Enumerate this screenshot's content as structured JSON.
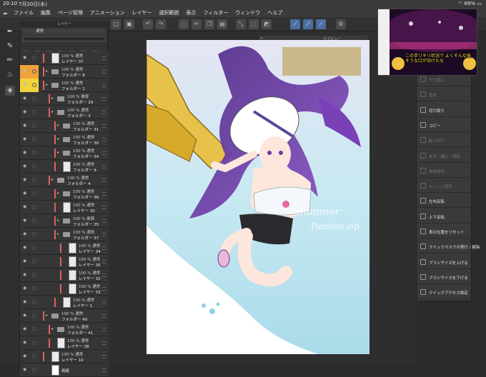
{
  "status_bar": {
    "time": "20:10",
    "date": "7月20日(水)",
    "battery": "69%"
  },
  "menu_bar": {
    "items": [
      "ファイル",
      "編集",
      "ページ管理",
      "アニメーション",
      "レイヤー",
      "選択範囲",
      "表示",
      "フィルター",
      "ウィンドウ",
      "ヘルプ"
    ]
  },
  "layer_panel": {
    "title": "レイヤー",
    "blend_mode": "通常",
    "layers": [
      {
        "line1": "100 % 通常",
        "line2": "レイヤー 37",
        "kind": "layer",
        "indent": 40,
        "color": ""
      },
      {
        "line1": "100 % 通常",
        "line2": "フォルダー 8",
        "kind": "folder",
        "indent": 40,
        "color": "orange"
      },
      {
        "line1": "100 % 通常",
        "line2": "フォルダー 1",
        "kind": "folder",
        "indent": 40,
        "color": "yellow"
      },
      {
        "line1": "100 % 乗算",
        "line2": "フォルダー 29",
        "kind": "folder",
        "indent": 48,
        "color": ""
      },
      {
        "line1": "100 % 通常",
        "line2": "フォルダー 3",
        "kind": "folder",
        "indent": 48,
        "color": ""
      },
      {
        "line1": "100 % 通常",
        "line2": "フォルダー 31",
        "kind": "folder",
        "indent": 56,
        "color": ""
      },
      {
        "line1": "100 % 通常",
        "line2": "フォルダー 30",
        "kind": "folder",
        "indent": 56,
        "color": ""
      },
      {
        "line1": "100 % 通常",
        "line2": "フォルダー 34",
        "kind": "folder",
        "indent": 56,
        "color": ""
      },
      {
        "line1": "100 % 通常",
        "line2": "フォルダー 9",
        "kind": "layer",
        "indent": 56,
        "color": ""
      },
      {
        "line1": "100 % 通常",
        "line2": "フォルダー 4",
        "kind": "folder",
        "indent": 48,
        "color": ""
      },
      {
        "line1": "100 % 通常",
        "line2": "フォルダー 36",
        "kind": "folder",
        "indent": 56,
        "color": ""
      },
      {
        "line1": "100 % 通常",
        "line2": "レイヤー 30",
        "kind": "layer",
        "indent": 56,
        "color": ""
      },
      {
        "line1": "100 % 乗算",
        "line2": "フォルダー 35",
        "kind": "folder",
        "indent": 56,
        "color": ""
      },
      {
        "line1": "100 % 通常",
        "line2": "フォルダー 37",
        "kind": "folder",
        "indent": 56,
        "color": ""
      },
      {
        "line1": "100 % 通常",
        "line2": "レイヤー 34",
        "kind": "layer",
        "indent": 64,
        "color": ""
      },
      {
        "line1": "100 % 通常",
        "line2": "レイヤー 35",
        "kind": "layer",
        "indent": 64,
        "color": ""
      },
      {
        "line1": "100 % 通常",
        "line2": "レイヤー 32",
        "kind": "layer",
        "indent": 64,
        "color": ""
      },
      {
        "line1": "100 % 通常",
        "line2": "レイヤー 33",
        "kind": "layer",
        "indent": 64,
        "color": ""
      },
      {
        "line1": "100 % 通常",
        "line2": "レイヤー 1",
        "kind": "layer",
        "indent": 56,
        "color": ""
      },
      {
        "line1": "100 % 通常",
        "line2": "フォルダー 40",
        "kind": "folder",
        "indent": 40,
        "color": ""
      },
      {
        "line1": "100 % 通常",
        "line2": "フォルダー 41",
        "kind": "folder",
        "indent": 48,
        "color": ""
      },
      {
        "line1": "100 % 通常",
        "line2": "レイヤー 38",
        "kind": "layer",
        "indent": 48,
        "color": ""
      },
      {
        "line1": "100 % 通常",
        "line2": "レイヤー 10",
        "kind": "layer",
        "indent": 40,
        "color": ""
      },
      {
        "line1": "",
        "line2": "用紙",
        "kind": "paper",
        "indent": 40,
        "color": ""
      }
    ]
  },
  "canvas": {
    "subview_label": "サブビュー",
    "artwork_text_1": "Summer",
    "artwork_text_2": "Passion vip"
  },
  "context_menu": {
    "items": [
      {
        "label": "やり直し",
        "enabled": false
      },
      {
        "label": "消去",
        "enabled": false
      },
      {
        "label": "切り取り",
        "enabled": true
      },
      {
        "label": "コピー",
        "enabled": true
      },
      {
        "label": "貼り付け",
        "enabled": false
      },
      {
        "label": "拡大・縮小・回転",
        "enabled": false
      },
      {
        "label": "自由変形",
        "enabled": false
      },
      {
        "label": "メッシュ変形",
        "enabled": false
      },
      {
        "label": "左右反転",
        "enabled": true
      },
      {
        "label": "上下反転",
        "enabled": true
      },
      {
        "label": "表示位置をリセット",
        "enabled": true
      },
      {
        "label": "クイックマスクの実行 / 解除",
        "enabled": true
      },
      {
        "label": "ブラシサイズを上げる",
        "enabled": true
      },
      {
        "label": "ブラシサイズを下げる",
        "enabled": true
      },
      {
        "label": "クイックアクセス設定",
        "enabled": true
      }
    ]
  },
  "video_overlay": {
    "subtitle": "この手リキリ状況で よくそんな強そうな口が効けたな"
  },
  "colors": {
    "accent": "#4b6fa0",
    "folder_orange": "#f0a23a",
    "folder_yellow": "#f2d43c",
    "artwork_sky": "#b9e3ef",
    "artwork_hair": "#6b3a9e"
  }
}
